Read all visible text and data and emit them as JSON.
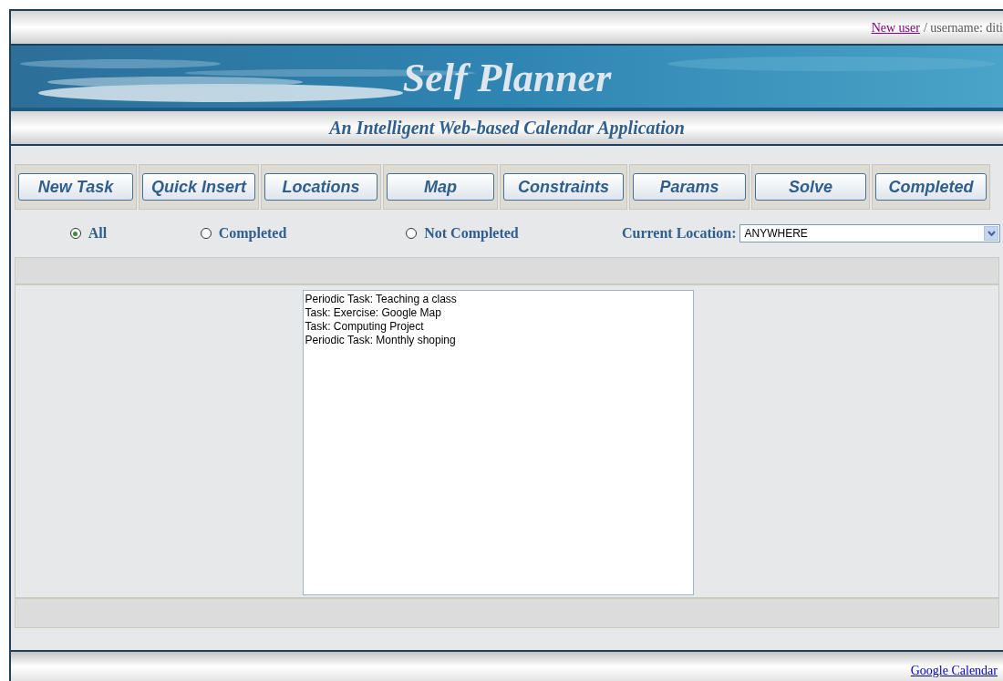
{
  "top_bar": {
    "link": "New user",
    "text": "/ username: diti"
  },
  "banner": {
    "title": "Self Planner",
    "subtitle": "An Intelligent Web-based Calendar Application"
  },
  "nav_buttons": [
    "New Task",
    "Quick Insert",
    "Locations",
    "Map",
    "Constraints",
    "Params",
    "Solve",
    "Completed"
  ],
  "filters": [
    {
      "label": "All",
      "selected": true
    },
    {
      "label": "Completed",
      "selected": false
    },
    {
      "label": "Not Completed",
      "selected": false
    }
  ],
  "location": {
    "label": "Current Location:",
    "value": "ANYWHERE"
  },
  "tasks": [
    {
      "label": "Periodic Task: Teaching a class"
    },
    {
      "label": "Task: Exercise: Google Map"
    },
    {
      "label": "Task: Computing Project"
    },
    {
      "label": "Periodic Task: Monthly shoping"
    }
  ],
  "footer": {
    "link": "Google Calendar"
  }
}
